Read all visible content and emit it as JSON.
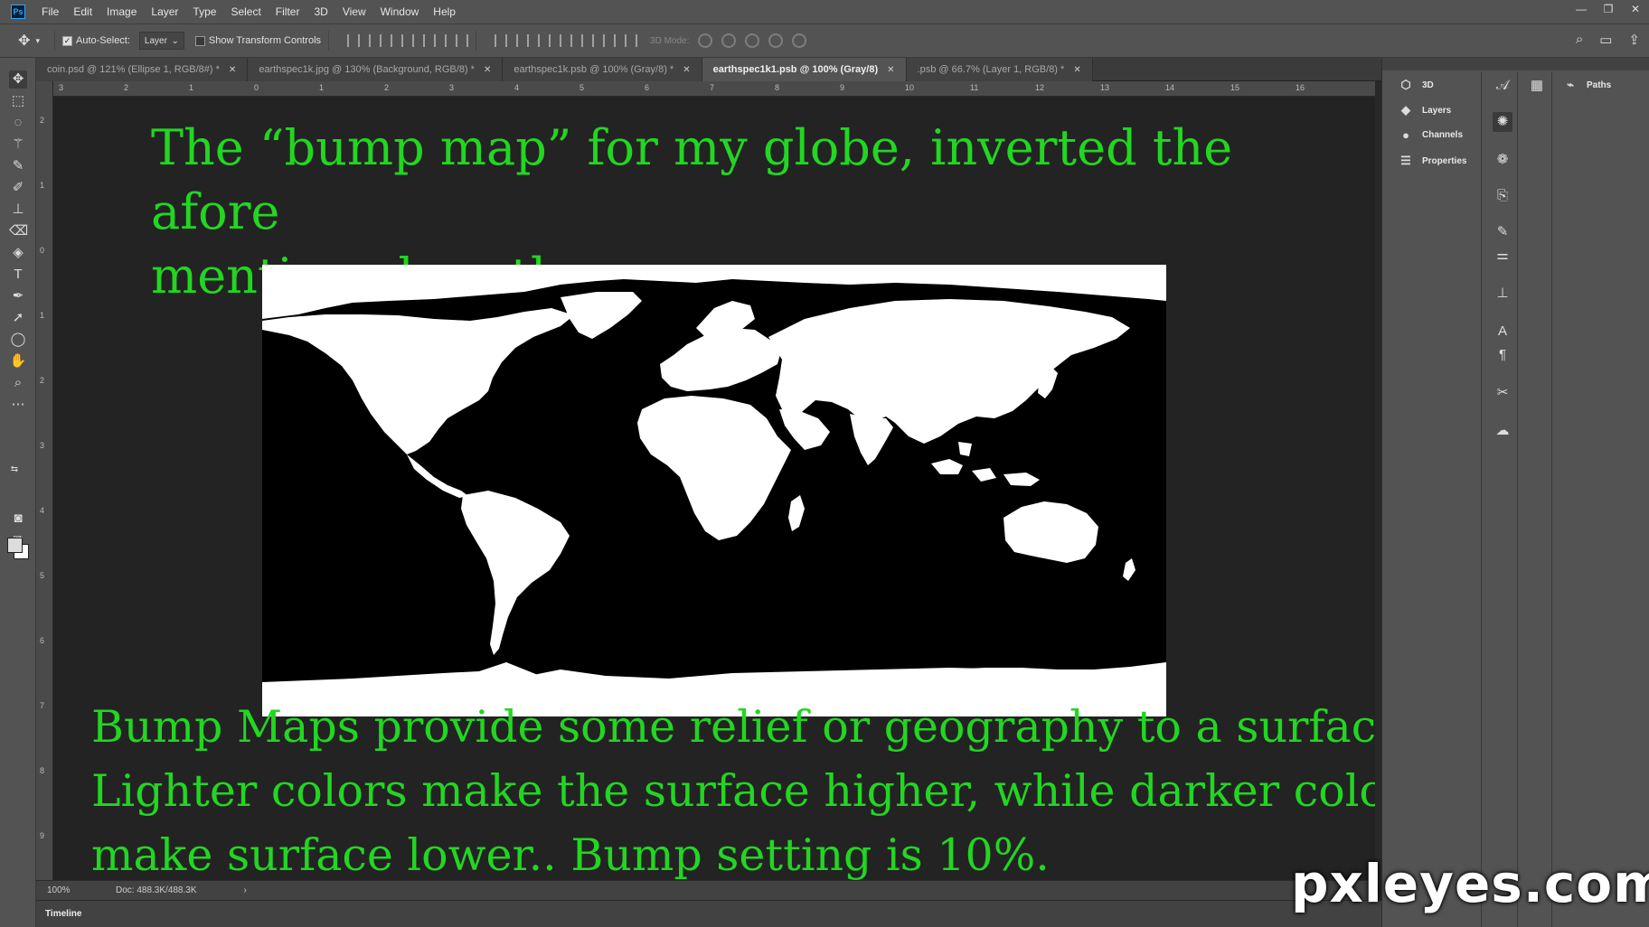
{
  "app": {
    "logo": "Ps"
  },
  "menu": [
    "File",
    "Edit",
    "Image",
    "Layer",
    "Type",
    "Select",
    "Filter",
    "3D",
    "View",
    "Window",
    "Help"
  ],
  "window_controls": {
    "minimize": "—",
    "restore": "❐",
    "close": "✕"
  },
  "options_bar": {
    "auto_select_label": "Auto-Select:",
    "auto_select_checked": true,
    "auto_select_target": "Layer",
    "show_transform_label": "Show Transform Controls",
    "show_transform_checked": false,
    "mode_label": "3D Mode:"
  },
  "tabs": [
    {
      "label": "coin.psd @ 121% (Ellipse 1, RGB/8#) *",
      "active": false
    },
    {
      "label": "earthspec1k.jpg @ 130% (Background, RGB/8) *",
      "active": false
    },
    {
      "label": "earthspec1k.psb @ 100% (Gray/8) *",
      "active": false
    },
    {
      "label": "earthspec1k1.psb @ 100% (Gray/8)",
      "active": true
    },
    {
      "label": ".psb @ 66.7% (Layer 1, RGB/8) *",
      "active": false
    }
  ],
  "ruler_top": [
    "3",
    "2",
    "1",
    "0",
    "1",
    "2",
    "3",
    "4",
    "5",
    "6",
    "7",
    "8",
    "9",
    "10",
    "11",
    "12",
    "13",
    "14",
    "15",
    "16"
  ],
  "ruler_left": [
    "2",
    "1",
    "0",
    "1",
    "2",
    "3",
    "4",
    "5",
    "6",
    "7",
    "8",
    "9"
  ],
  "document": {
    "top_text_line1": "The “bump map” for my globe, inverted the afore",
    "top_text_line2": "mentioned earth map.",
    "bottom_text_line1": "Bump Maps provide some relief or geography to a surface.",
    "bottom_text_line2": "Lighter colors make the surface higher, while darker color",
    "bottom_text_line3": "make surface lower.. Bump setting is 10%.",
    "text_color": "#22d622"
  },
  "status": {
    "zoom": "100%",
    "doc": "Doc: 488.3K/488.3K",
    "arrow": "›"
  },
  "timeline_label": "Timeline",
  "panels": [
    {
      "label": "3D",
      "icon": "cube-icon"
    },
    {
      "label": "Layers",
      "icon": "layers-icon"
    },
    {
      "label": "Channels",
      "icon": "channels-icon"
    },
    {
      "label": "Properties",
      "icon": "properties-icon"
    }
  ],
  "paths_panel": {
    "label": "Paths"
  },
  "watermark": "pxleyes.com"
}
